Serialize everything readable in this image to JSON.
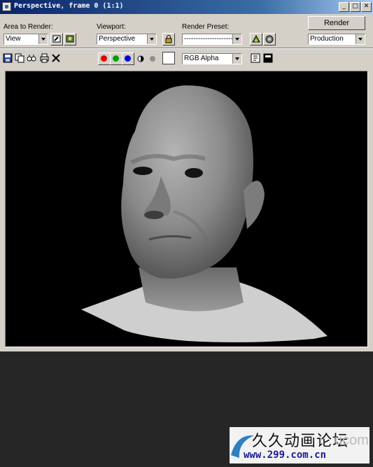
{
  "window": {
    "title": "Perspective, frame 0 (1:1)"
  },
  "controls": {
    "area_label": "Area to Render:",
    "area_value": "View",
    "viewport_label": "Viewport:",
    "viewport_value": "Perspective",
    "preset_label": "Render Preset:",
    "preset_value": "-------------------------",
    "render_label": "Render",
    "production_value": "Production",
    "channel_value": "RGB Alpha"
  },
  "colors": {
    "red": "#e00000",
    "green": "#00a000",
    "blue": "#0000e0",
    "viewport_bg": "#000000",
    "title_bar": "#0a246a"
  },
  "watermark": {
    "line1": "久久动画论坛",
    "line2": "www.299.com.cn",
    "brand": "ucom"
  }
}
